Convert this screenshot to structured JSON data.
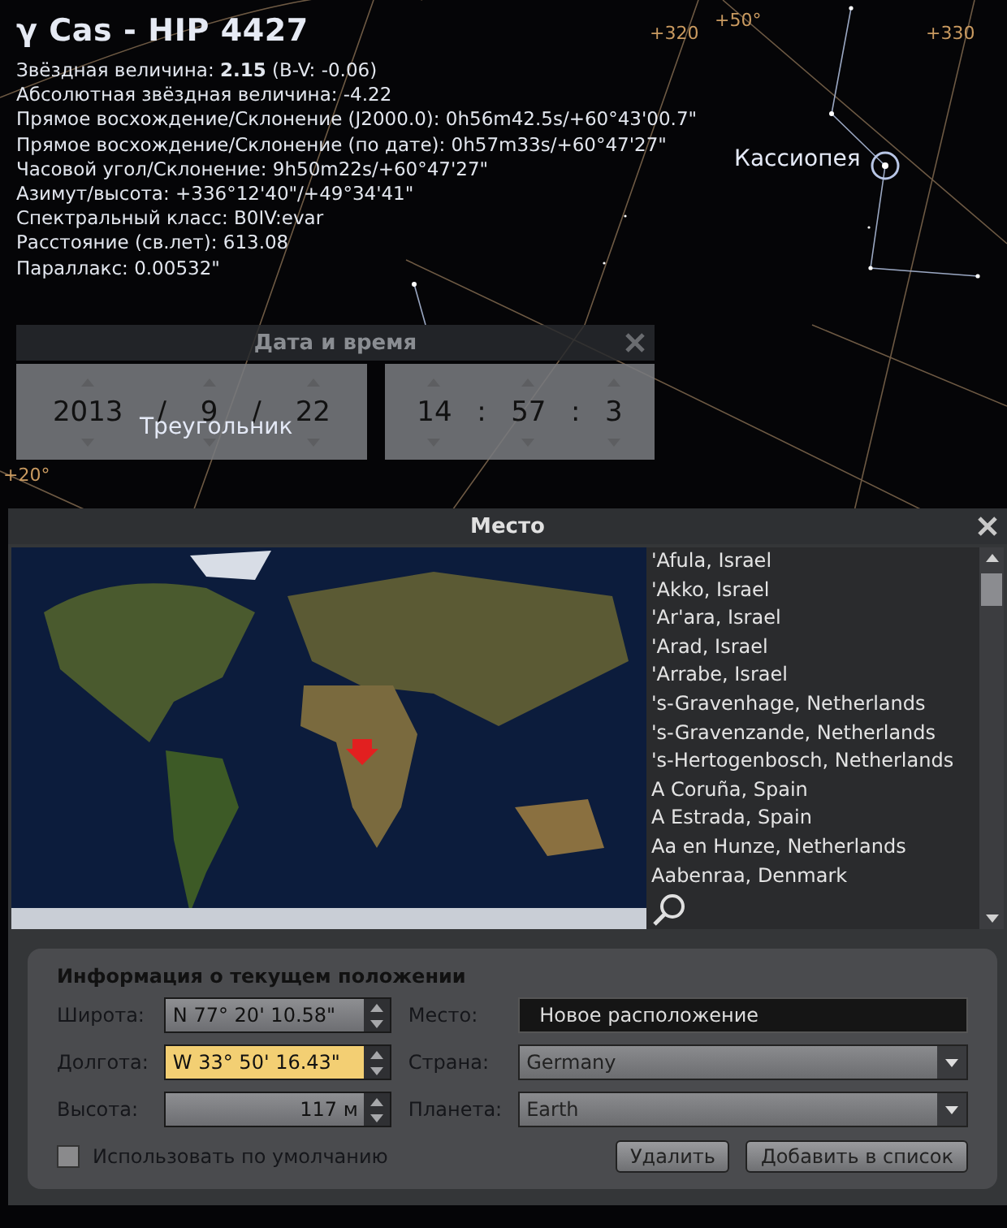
{
  "object_info": {
    "title": "γ Cas - HIP 4427",
    "lines": [
      "Звёздная величина: **2.15** (B-V: -0.06)",
      "Абсолютная звёздная величина: -4.22",
      "Прямое восхождение/Склонение (J2000.0): 0h56m42.5s/+60°43'00.7\"",
      "Прямое восхождение/Склонение (по дате): 0h57m33s/+60°47'27\"",
      "Часовой угол/Склонение: 9h50m22s/+60°47'27\"",
      "Азимут/высота: +336°12'40\"/+49°34'41\"",
      "Спектральный класс: B0IV:evar",
      "Расстояние (св.лет): 613.08",
      "Параллакс: 0.00532\""
    ]
  },
  "sky_labels": [
    {
      "kind": "constellation",
      "text": "Кассиопея"
    },
    {
      "kind": "constellation",
      "text": "Треугольник"
    },
    {
      "kind": "grid",
      "text": "+320"
    },
    {
      "kind": "grid",
      "text": "+50°"
    },
    {
      "kind": "grid",
      "text": "+330"
    },
    {
      "kind": "grid",
      "text": "+20°"
    }
  ],
  "date_time": {
    "title": "Дата и время",
    "date": [
      "2013",
      "9",
      "22"
    ],
    "date_separator": "/",
    "time": [
      "14",
      "57",
      "3"
    ],
    "time_separator": ":"
  },
  "location": {
    "title": "Место",
    "places": [
      "'Afula, Israel",
      "'Akko, Israel",
      "'Ar'ara, Israel",
      "'Arad, Israel",
      "'Arrabe, Israel",
      "'s-Gravenhage, Netherlands",
      "'s-Gravenzande, Netherlands",
      "'s-Hertogenbosch, Netherlands",
      "A Coruña, Spain",
      "A Estrada, Spain",
      "Aa en Hunze, Netherlands",
      "Aabenraa, Denmark"
    ],
    "info": {
      "heading": "Информация о текущем положении",
      "coords": [
        {
          "label": "Широта:",
          "value": "N 77° 20' 10.58\"",
          "focused": false
        },
        {
          "label": "Долгота:",
          "value": "W 33° 50' 16.43\"",
          "focused": true
        },
        {
          "label": "Высота:",
          "value": "117 м",
          "focused": false
        }
      ],
      "details": [
        {
          "kind": "text",
          "label": "Место:",
          "value": "Новое расположение"
        },
        {
          "kind": "dropdown",
          "label": "Страна:",
          "value": "Germany"
        },
        {
          "kind": "dropdown",
          "label": "Планета:",
          "value": "Earth"
        }
      ],
      "default_checkbox": {
        "label": "Использовать по умолчанию",
        "checked": false
      },
      "buttons": [
        "Удалить",
        "Добавить в список"
      ]
    }
  }
}
